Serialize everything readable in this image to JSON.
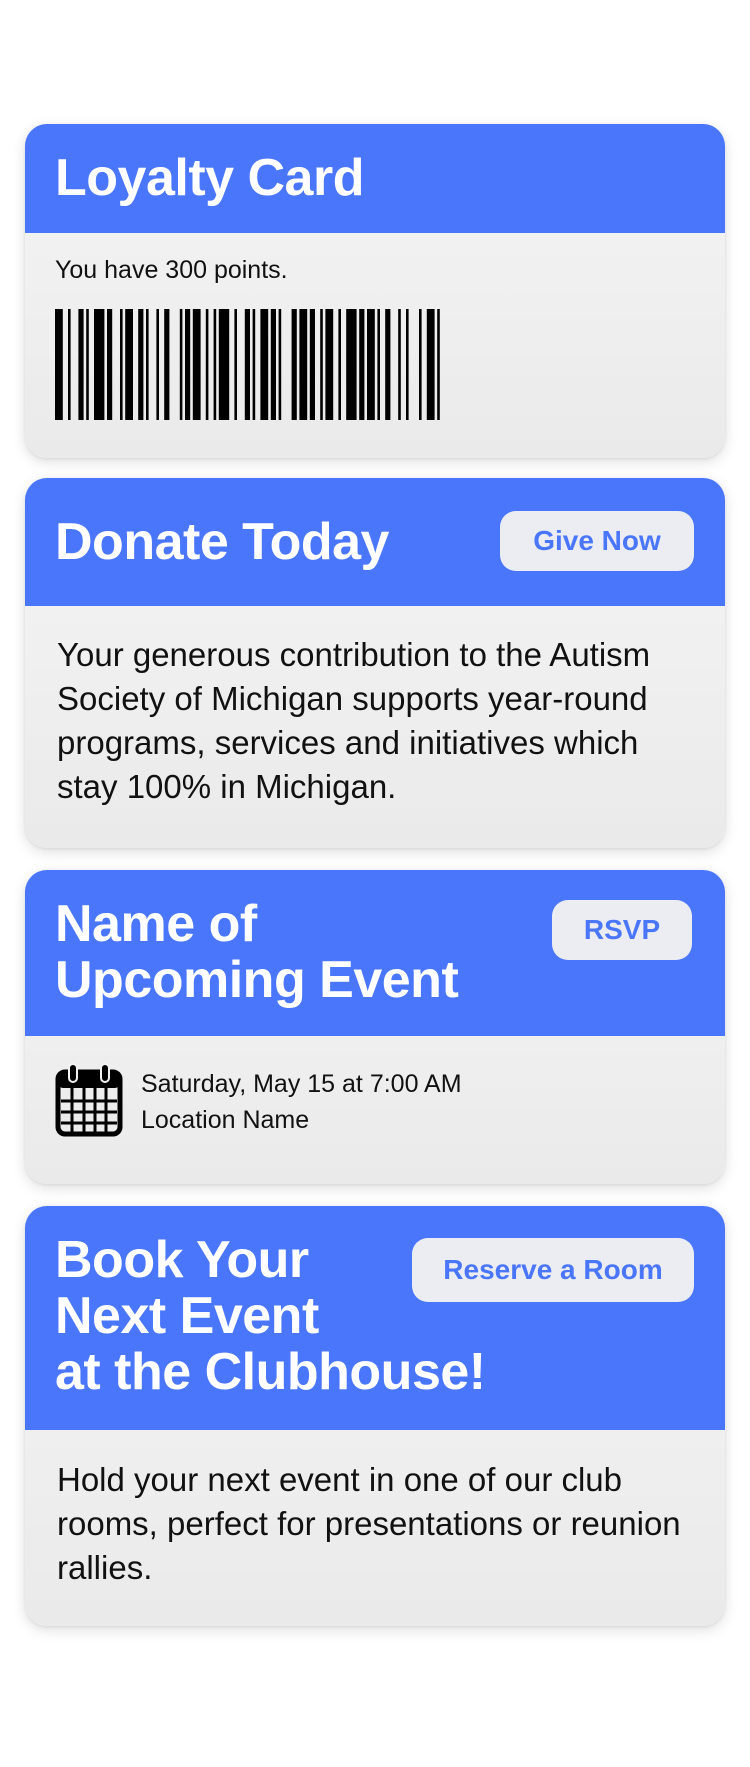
{
  "loyalty": {
    "title": "Loyalty Card",
    "points_text": "You have 300 points."
  },
  "donate": {
    "title": "Donate Today",
    "button": "Give Now",
    "body": "Your generous contribution to the Autism Society of Michigan supports year-round programs, services and initiatives which stay 100% in Michigan."
  },
  "event": {
    "title_line1": "Name of",
    "title_line2": "Upcoming Event",
    "button": "RSVP",
    "date": "Saturday, May 15 at 7:00 AM",
    "location": "Location Name",
    "icon": "calendar-icon"
  },
  "book": {
    "title_line1": "Book Your",
    "title_line2": "Next Event",
    "title_line3": "at the Clubhouse!",
    "button": "Reserve a Room",
    "body": "Hold your next event in one of our club rooms, perfect for presentations or reunion rallies."
  },
  "colors": {
    "accent": "#4a76fb",
    "button_bg": "#ececf3",
    "card_bg": "#f2f2f2"
  }
}
